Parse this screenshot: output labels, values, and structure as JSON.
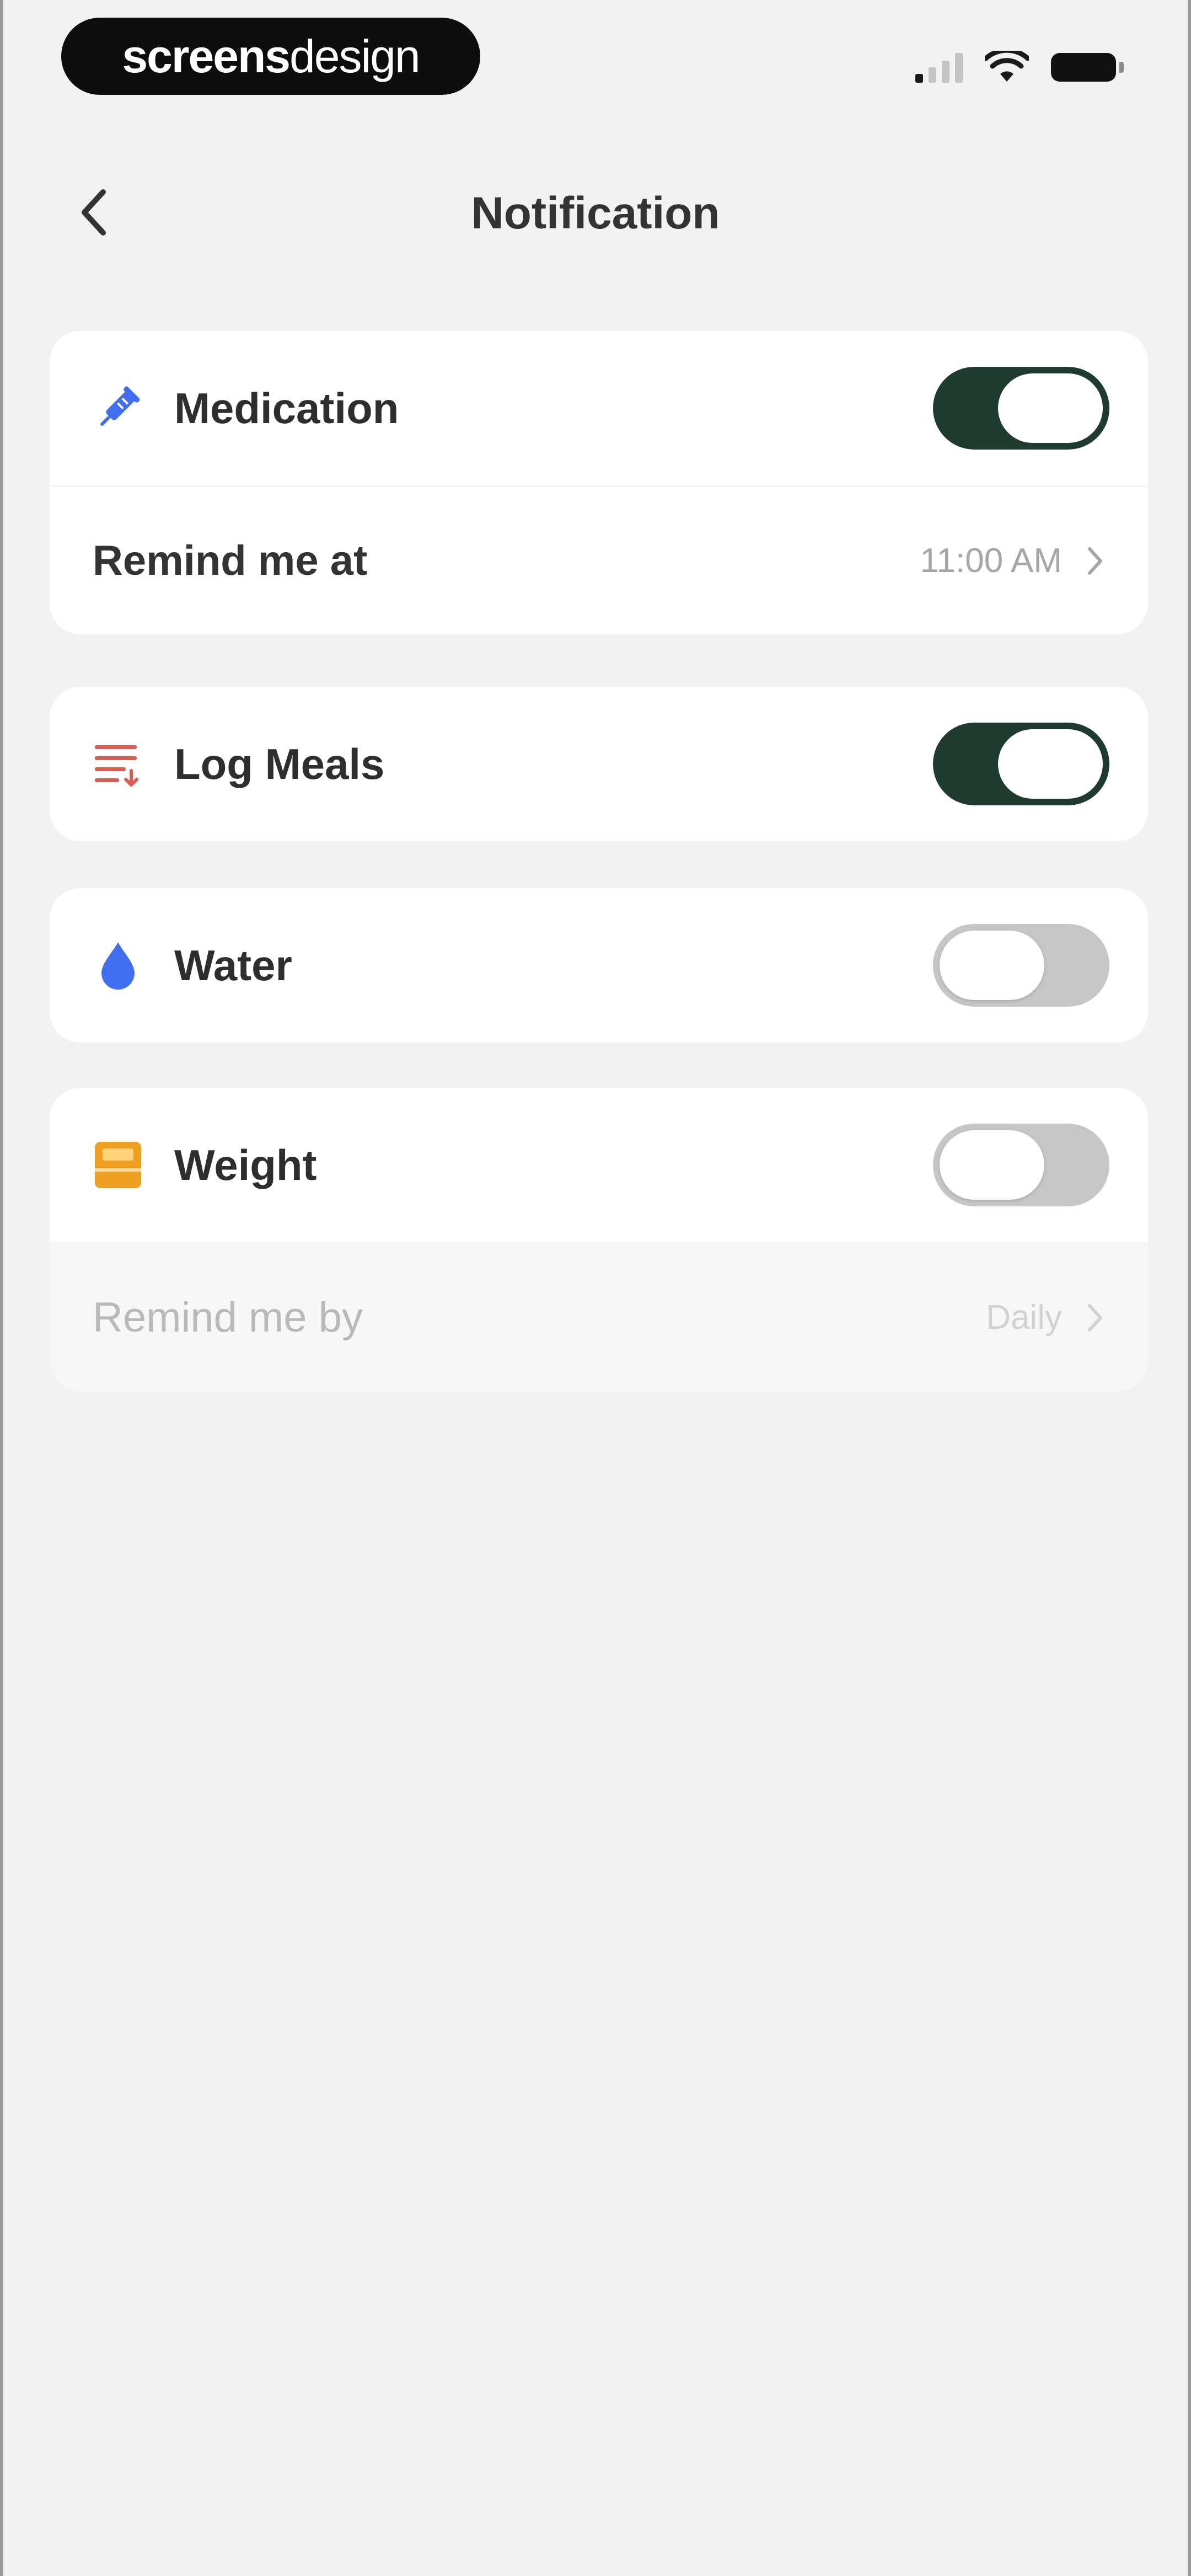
{
  "status_bar": {
    "brand_bold": "screens",
    "brand_light": "design"
  },
  "header": {
    "title": "Notification"
  },
  "medication": {
    "label": "Medication",
    "enabled": true,
    "remind_label": "Remind me at",
    "remind_value": "11:00 AM"
  },
  "log_meals": {
    "label": "Log Meals",
    "enabled": true
  },
  "water": {
    "label": "Water",
    "enabled": false
  },
  "weight": {
    "label": "Weight",
    "enabled": false,
    "remind_label": "Remind me by",
    "remind_value": "Daily"
  },
  "colors": {
    "toggle_on": "#1f3b30",
    "toggle_off": "#c6c6c6",
    "medication_icon": "#3f6ff0",
    "log_meals_icon": "#e05a4f",
    "water_icon": "#3f6ff0",
    "weight_icon": "#f0a020"
  },
  "icons": {
    "back": "chevron-left-icon",
    "medication": "syringe-icon",
    "log_meals": "list-icon",
    "water": "water-drop-icon",
    "weight": "scale-icon",
    "row_arrow": "chevron-right-icon"
  }
}
